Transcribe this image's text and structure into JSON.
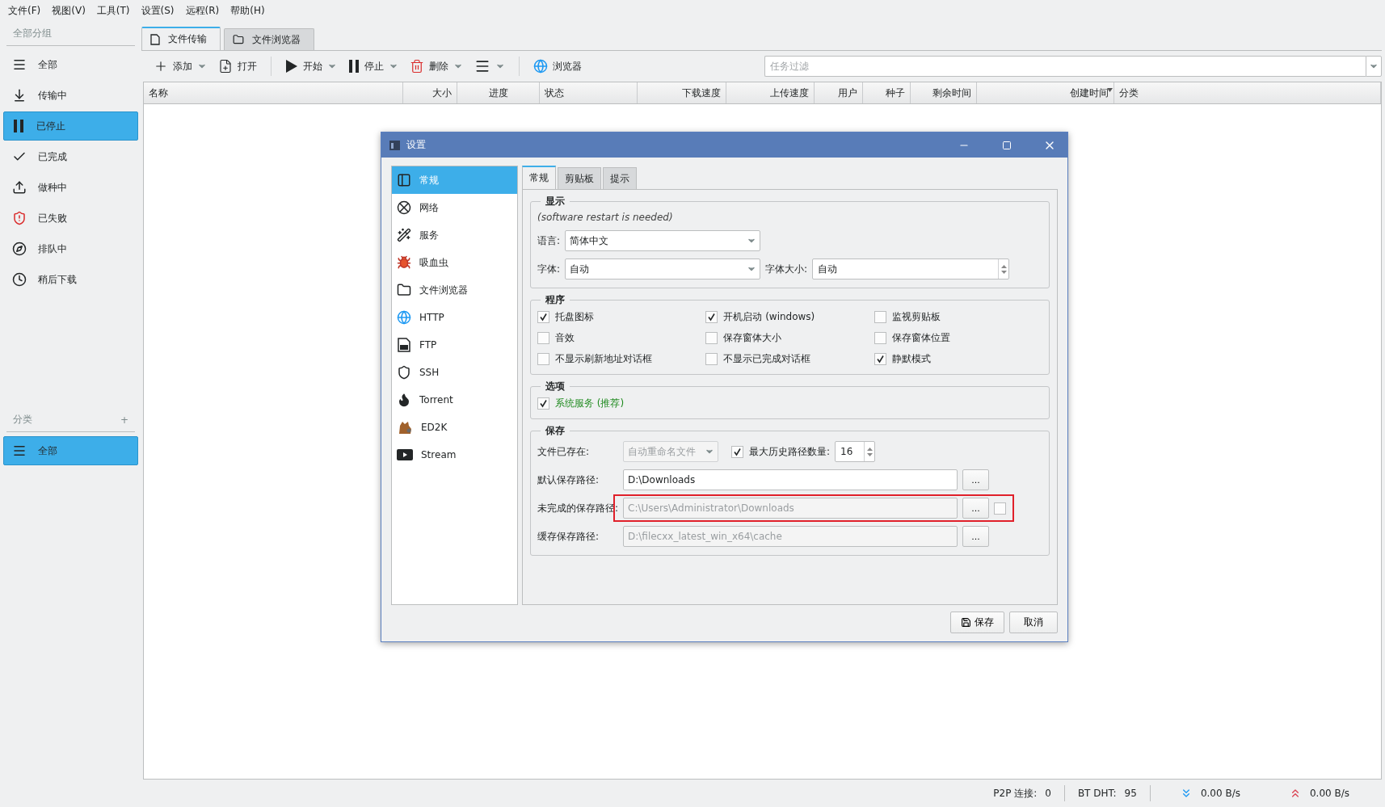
{
  "menu": [
    "文件(F)",
    "视图(V)",
    "工具(T)",
    "设置(S)",
    "远程(R)",
    "帮助(H)"
  ],
  "sidebar": {
    "group_title": "全部分组",
    "items": [
      {
        "label": "全部",
        "selected": false
      },
      {
        "label": "传输中",
        "selected": false
      },
      {
        "label": "已停止",
        "selected": true
      },
      {
        "label": "已完成",
        "selected": false
      },
      {
        "label": "做种中",
        "selected": false
      },
      {
        "label": "已失败",
        "selected": false
      },
      {
        "label": "排队中",
        "selected": false
      },
      {
        "label": "稍后下载",
        "selected": false
      }
    ],
    "category_title": "分类",
    "add_label": "+",
    "category_items": [
      {
        "label": "全部",
        "selected": true
      }
    ]
  },
  "tabs": [
    {
      "label": "文件传输",
      "selected": true
    },
    {
      "label": "文件浏览器",
      "selected": false
    }
  ],
  "toolbar": {
    "buttons": [
      {
        "label": "添加",
        "dropdown": true
      },
      {
        "label": "打开",
        "dropdown": false
      },
      {
        "label": "开始",
        "dropdown": true
      },
      {
        "label": "停止",
        "dropdown": true
      },
      {
        "label": "删除",
        "dropdown": true
      },
      {
        "dropdown": true
      },
      {
        "label": "浏览器",
        "dropdown": false
      }
    ],
    "filter": {
      "placeholder": "任务过滤"
    }
  },
  "table": {
    "columns": [
      {
        "label": "名称",
        "sorted": false
      },
      {
        "label": "大小",
        "sorted": false
      },
      {
        "label": "进度",
        "sorted": false
      },
      {
        "label": "状态",
        "sorted": false
      },
      {
        "label": "下载速度",
        "sorted": false
      },
      {
        "label": "上传速度",
        "sorted": false
      },
      {
        "label": "用户",
        "sorted": false
      },
      {
        "label": "种子",
        "sorted": false
      },
      {
        "label": "剩余时间",
        "sorted": false
      },
      {
        "label": "创建时间",
        "sorted": true
      },
      {
        "label": "分类",
        "sorted": false
      }
    ]
  },
  "dialog": {
    "title": "设置",
    "nav": [
      {
        "label": "常规",
        "selected": true
      },
      {
        "label": "网络",
        "selected": false
      },
      {
        "label": "服务",
        "selected": false
      },
      {
        "label": "吸血虫",
        "selected": false
      },
      {
        "label": "文件浏览器",
        "selected": false
      },
      {
        "label": "HTTP",
        "selected": false
      },
      {
        "label": "FTP",
        "selected": false
      },
      {
        "label": "SSH",
        "selected": false
      },
      {
        "label": "Torrent",
        "selected": false
      },
      {
        "label": "ED2K",
        "selected": false
      },
      {
        "label": "Stream",
        "selected": false
      }
    ],
    "tabs": [
      {
        "label": "常规",
        "selected": true
      },
      {
        "label": "剪贴板",
        "selected": false
      },
      {
        "label": "提示",
        "selected": false
      }
    ],
    "display": {
      "title": "显示",
      "note": "(software restart is needed)",
      "language_label": "语言:",
      "language": "简体中文",
      "font_label": "字体:",
      "font": "自动",
      "font_size_label": "字体大小:",
      "font_size": "自动"
    },
    "program": {
      "title": "程序",
      "options": [
        {
          "label": "托盘图标",
          "checked": true
        },
        {
          "label": "开机启动 (windows)",
          "checked": true
        },
        {
          "label": "监视剪贴板",
          "checked": false
        },
        {
          "label": "音效",
          "checked": false
        },
        {
          "label": "保存窗体大小",
          "checked": false
        },
        {
          "label": "保存窗体位置",
          "checked": false
        },
        {
          "label": "不显示刷新地址对话框",
          "checked": false
        },
        {
          "label": "不显示已完成对话框",
          "checked": false
        },
        {
          "label": "静默模式",
          "checked": true
        }
      ]
    },
    "options": {
      "title": "选项",
      "items": [
        {
          "label": "系统服务 (推荐)",
          "checked": true
        }
      ]
    },
    "save": {
      "title": "保存",
      "exists_label": "文件已存在:",
      "exists_value": "自动重命名文件",
      "exists_disabled": true,
      "history": {
        "label": "最大历史路径数量:",
        "checked": true,
        "value": "16"
      },
      "paths": [
        {
          "label": "默认保存路径:",
          "value": "D:\\Downloads",
          "disabled": false,
          "browse": "...",
          "kind": "plain",
          "highlighted": false
        },
        {
          "label": "未完成的保存路径:",
          "value": "C:\\Users\\Administrator\\Downloads",
          "disabled": true,
          "browse": "...",
          "kind": "toggle",
          "checked": false,
          "highlighted": true
        },
        {
          "label": "缓存保存路径:",
          "value": "D:\\filecxx_latest_win_x64\\cache",
          "disabled": true,
          "browse": "...",
          "kind": "plain",
          "highlighted": false
        }
      ]
    },
    "buttons": [
      {
        "label": "保存",
        "kind": "save"
      },
      {
        "label": "取消",
        "kind": "plain"
      }
    ]
  },
  "status": {
    "p2p_label": "P2P 连接:",
    "p2p": "0",
    "dht_label": "BT DHT:",
    "dht": "95",
    "download": "0.00 B/s",
    "upload": "0.00 B/s"
  }
}
